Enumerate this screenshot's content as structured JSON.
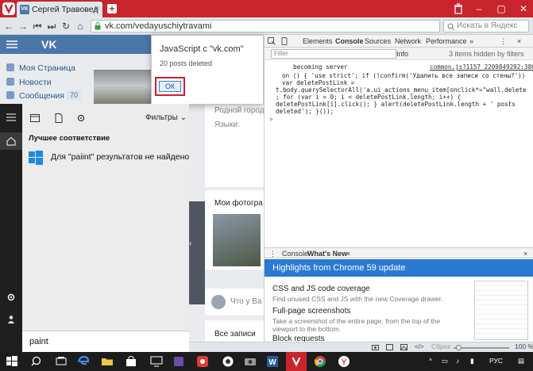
{
  "browser": {
    "tab_title": "Сергей Травовед",
    "tab_favicon": "VK",
    "url": "vk.com/vedayuschiytravami",
    "search_placeholder": "Искать в Яндекс",
    "zoom": "100 %",
    "reset_label": "Сброс"
  },
  "vk": {
    "logo": "VK",
    "nav": [
      {
        "label": "Моя Страница",
        "icon": "user-icon"
      },
      {
        "label": "Новости",
        "icon": "news-icon"
      },
      {
        "label": "Сообщения",
        "icon": "chat-icon"
      }
    ],
    "messages_count": "70",
    "profile_lines": [
      "Родной город:",
      "Языки:"
    ],
    "photos_title": "Мои фотогра",
    "post_placeholder": "Что у Ва",
    "all_posts": "Все записи"
  },
  "dialog": {
    "title": "JavaScript с \"vk.com\"",
    "message": "20 posts deleted",
    "ok": "ОК"
  },
  "devtools": {
    "tabs": [
      "Elements",
      "Console",
      "Sources",
      "Network",
      "Performance"
    ],
    "active_tab": "Console",
    "filter_placeholder": "Filter",
    "level": "Info",
    "hidden_note": "3 items hidden by filters",
    "log_line": "becoming server",
    "log_source": "common.js?1157_2209849292:380",
    "code": [
      "on () { 'use strict'; if (!confirm('Удалить все записи со стены?'))",
      "var deletePostLink =",
      "t.body.querySelectorAll('a.ui_actions_menu_item[onclick*=\"wall.delete",
      "; for (var i = 0; i < deletePostLink.length; i++) {",
      "deletePostLink[i].click(); } alert(deletePostLink.length + ' posts",
      "deleted'); }());"
    ],
    "prompt": ">",
    "drawer_tabs": [
      "Console",
      "What's New"
    ],
    "whats_new_title": "Highlights from Chrome 59 update",
    "items": [
      {
        "title": "CSS and JS code coverage",
        "desc": [
          "Find unused CSS and JS with the new Coverage drawer."
        ]
      },
      {
        "title": "Full-page screenshots",
        "desc": [
          "Take a screenshot of the entire page, from the top of the",
          "viewport to the bottom."
        ]
      },
      {
        "title": "Block requests",
        "desc": []
      }
    ]
  },
  "start": {
    "filters_label": "Фильтры",
    "best_match": "Лучшее соответствие",
    "result_text": "Для \"paiint\" результатов не найдено",
    "search_text": "paint"
  },
  "taskbar": {
    "lang": "РУС",
    "icons": [
      "windows-icon",
      "search-icon",
      "task-view-icon",
      "edge-icon",
      "folder-icon",
      "store-icon",
      "vk-app-icon",
      "camera-icon",
      "word-icon",
      "vivaldi-icon",
      "chrome-icon",
      "yandex-icon"
    ]
  },
  "colors": {
    "vivaldi_red": "#c8242b",
    "vk_blue": "#4a76a8",
    "chrome_blue": "#2a7ad2",
    "ok_highlight": "#d01e2a"
  }
}
